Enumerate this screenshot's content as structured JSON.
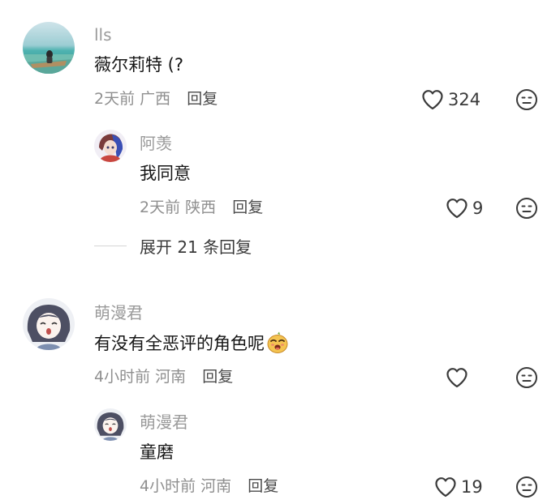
{
  "comments": [
    {
      "username": "lls",
      "content": "薇尔莉特 (?",
      "time": "2天前",
      "location": "广西",
      "reply_label": "回复",
      "likes": "324",
      "avatar_icon": "beach-photo-avatar",
      "replies": [
        {
          "username": "阿羡",
          "content": "我同意",
          "time": "2天前",
          "location": "陕西",
          "reply_label": "回复",
          "likes": "9",
          "avatar_icon": "anime-character-avatar"
        }
      ],
      "expand_label": "展开 21 条回复"
    },
    {
      "username": "萌漫君",
      "content": "有没有全恶评的角色呢",
      "content_emoji": "smug-face-emoji",
      "time": "4小时前",
      "location": "河南",
      "reply_label": "回复",
      "likes": "",
      "avatar_icon": "anime-girl-avatar",
      "replies": [
        {
          "username": "萌漫君",
          "content": "童磨",
          "time": "4小时前",
          "location": "河南",
          "reply_label": "回复",
          "likes": "19",
          "avatar_icon": "anime-girl-avatar"
        }
      ]
    }
  ],
  "colors": {
    "username": "#9a9a9a",
    "meta": "#8f8f8f",
    "content": "#161616",
    "icon": "#3a3a3a"
  }
}
